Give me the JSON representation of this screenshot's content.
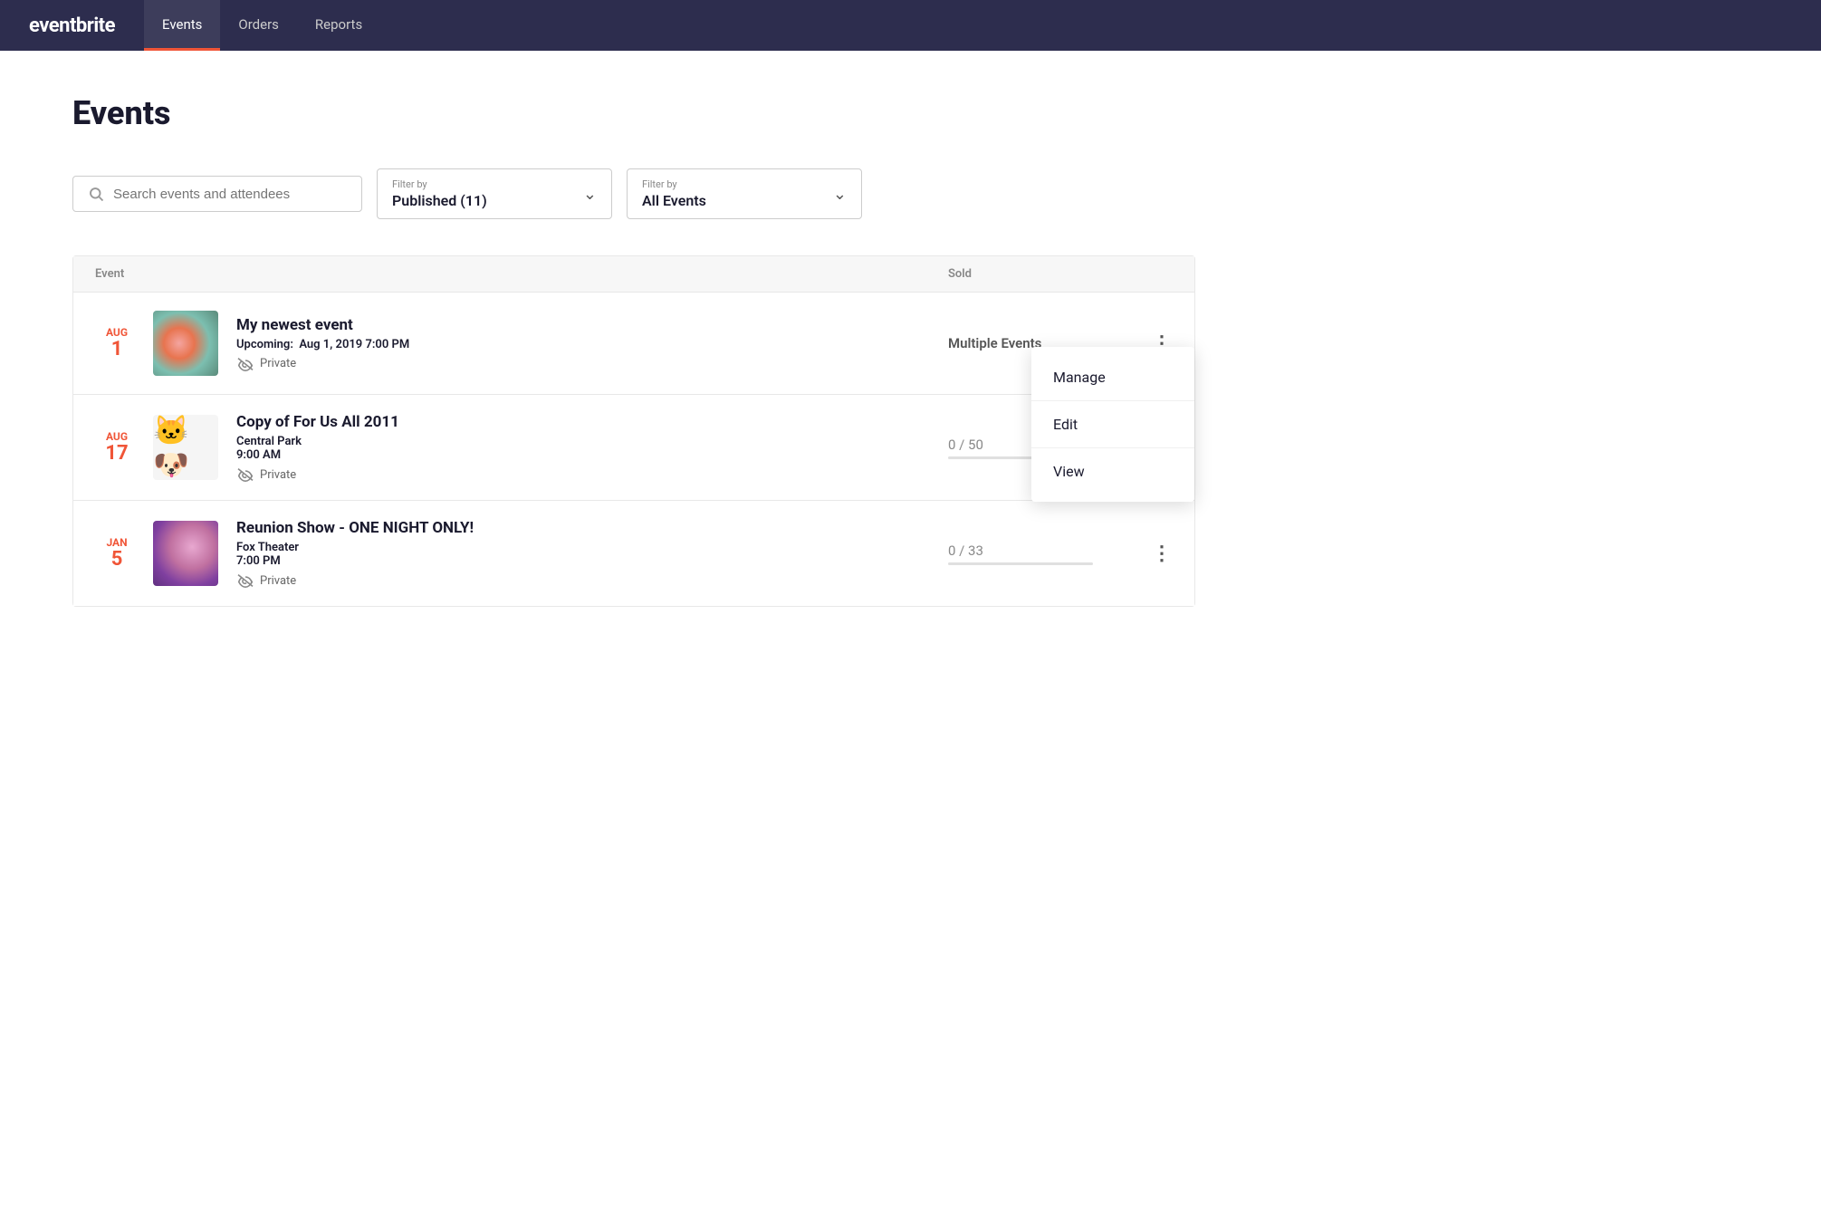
{
  "nav": {
    "logo_text": "eventbrite",
    "items": [
      {
        "label": "Events",
        "active": true
      },
      {
        "label": "Orders",
        "active": false
      },
      {
        "label": "Reports",
        "active": false
      }
    ]
  },
  "page": {
    "title": "Events"
  },
  "filters": {
    "search_placeholder": "Search events and attendees",
    "filter1_label": "Filter by",
    "filter1_value": "Published (11)",
    "filter2_label": "Filter by",
    "filter2_value": "All Events"
  },
  "table": {
    "col_event": "Event",
    "col_sold": "Sold",
    "rows": [
      {
        "date_month": "Aug",
        "date_day": "1",
        "name": "My newest event",
        "meta_label": "Upcoming:",
        "meta_value": "Aug 1, 2019 7:00 PM",
        "location": "",
        "is_private": true,
        "private_label": "Private",
        "sold": "Multiple Events",
        "sold_type": "multiple",
        "thumb_type": "bokeh1",
        "has_menu": true,
        "menu_open": true
      },
      {
        "date_month": "Aug",
        "date_day": "17",
        "name": "Copy of For Us All 2011",
        "meta_label": "",
        "meta_value": "",
        "location": "Central Park",
        "time": "9:00 AM",
        "is_private": true,
        "private_label": "Private",
        "sold": "0 / 50",
        "sold_type": "number",
        "thumb_type": "cartoon",
        "has_menu": true,
        "menu_open": false
      },
      {
        "date_month": "Jan",
        "date_day": "5",
        "name": "Reunion Show - ONE NIGHT ONLY!",
        "meta_label": "",
        "meta_value": "",
        "location": "Fox Theater",
        "time": "7:00 PM",
        "is_private": true,
        "private_label": "Private",
        "sold": "0 / 33",
        "sold_type": "number",
        "thumb_type": "bokeh2",
        "has_menu": true,
        "menu_open": false
      }
    ]
  },
  "dropdown_menu": {
    "manage_label": "Manage",
    "edit_label": "Edit",
    "view_label": "View"
  }
}
